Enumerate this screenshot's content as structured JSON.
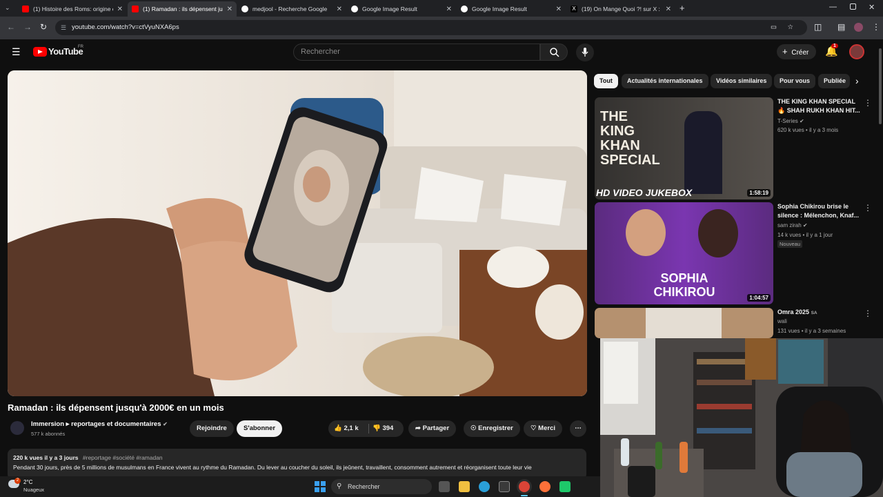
{
  "browser": {
    "tabs": [
      {
        "title": "(1) Histoire des Roms: origine e",
        "favicon_color": "#ff0000",
        "active": false
      },
      {
        "title": "(1) Ramadan : ils dépensent jus",
        "favicon_color": "#ff0000",
        "active": true
      },
      {
        "title": "medjool - Recherche Google",
        "favicon_color": "#4285f4",
        "active": false
      },
      {
        "title": "Google Image Result",
        "favicon_color": "#4285f4",
        "active": false
      },
      {
        "title": "Google Image Result",
        "favicon_color": "#4285f4",
        "active": false
      },
      {
        "title": "(19) On Mange Quoi ?! sur X : \"",
        "favicon_color": "#000000",
        "active": false
      }
    ],
    "new_tab": "+",
    "url": "youtube.com/watch?v=ctVyuNXA6ps"
  },
  "youtube": {
    "logo_text": "YouTube",
    "logo_region": "FR",
    "search_placeholder": "Rechercher",
    "create_label": "Créer",
    "notif_count": "1"
  },
  "video": {
    "title": "Ramadan : ils dépensent jusqu'à 2000€ en un mois",
    "channel": "Immersion ▸ reportages et documentaires",
    "subscribers": "577 k abonnés",
    "join_label": "Rejoindre",
    "subscribe_label": "S'abonner",
    "likes": "2,1 k",
    "dislikes": "394",
    "share_label": "Partager",
    "save_label": "Enregistrer",
    "thanks_label": "Merci",
    "views_date": "220 k vues  il y a 3 jours",
    "hashtags": "#reportage #société #ramadan",
    "description": "Pendant 30 jours, près de 5 millions de musulmans en France vivent au rythme du Ramadan. Du lever au coucher du soleil, ils jeûnent, travaillent, consomment autrement et réorganisent toute leur vie"
  },
  "chips": [
    "Tout",
    "Actualités internationales",
    "Vidéos similaires",
    "Pour vous",
    "Publiée"
  ],
  "recommendations": [
    {
      "title": "THE KING KHAN SPECIAL 🔥 SHAH RUKH KHAN HIT...",
      "channel": "T-Series",
      "meta": "620 k vues • il y a 3 mois",
      "duration": "1:58:19",
      "thumb_text": "THE KING KHAN SPECIAL",
      "thumb_sub": "HD VIDEO JUKEBOX",
      "badge": ""
    },
    {
      "title": "Sophia Chikirou brise le silence : Mélenchon, Knaf...",
      "channel": "sam zirah",
      "meta": "14 k vues • il y a 1 jour",
      "duration": "1:04:57",
      "thumb_text": "SOPHIA CHIKIROU",
      "thumb_sub": "",
      "badge": "Nouveau"
    },
    {
      "title": "Omra 2025",
      "title_suffix": "SA",
      "channel": "wali",
      "meta": "131 vues • il y a 3 semaines",
      "duration": "",
      "thumb_text": "",
      "thumb_sub": "",
      "badge": ""
    }
  ],
  "taskbar": {
    "weather_temp": "2°C",
    "weather_desc": "Nuageux",
    "weather_badge": "2",
    "search_label": "Rechercher"
  }
}
